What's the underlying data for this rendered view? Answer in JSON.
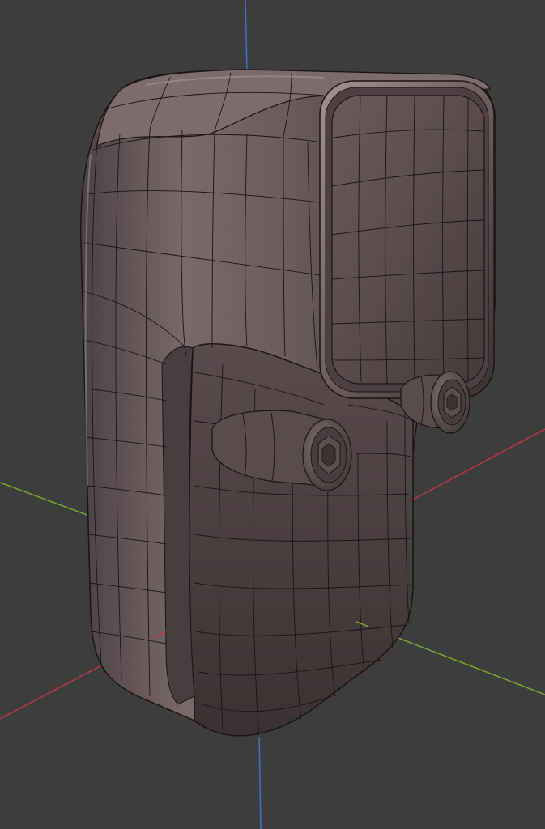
{
  "viewport": {
    "background_color": "#3d3d3d",
    "axis_colors": {
      "x": "#c03448",
      "y": "#7da52e",
      "z": "#3b73c6"
    }
  },
  "model": {
    "body_color": "#6f5e60",
    "wire_color": "#1b1516",
    "highlight_color": "#a79597",
    "shadow_color": "#3a2f30"
  }
}
